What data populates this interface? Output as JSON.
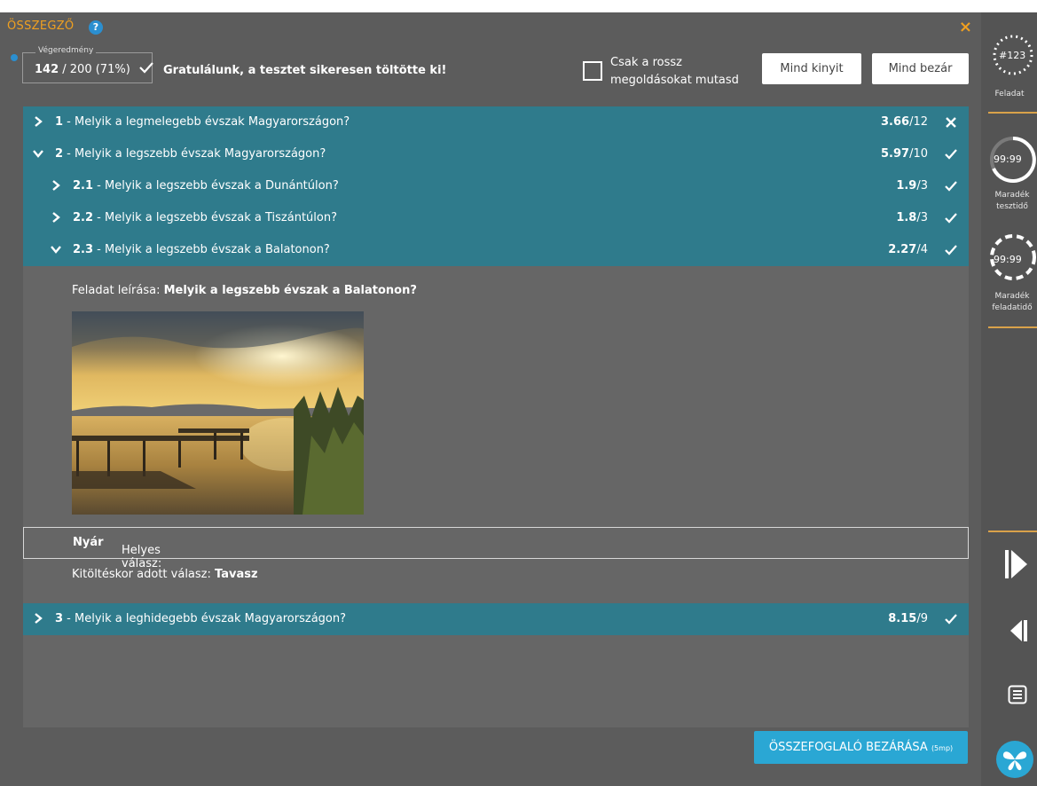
{
  "header": {
    "title": "ÖSSZEGZŐ",
    "help_icon": "?",
    "close_icon": "×"
  },
  "result": {
    "label": "Végeredmény",
    "score": "142",
    "rest": " / 200 (71%)",
    "message": "Gratulálunk, a tesztet sikeresen töltötte ki!"
  },
  "filter": {
    "checkbox_label": "Csak a rossz megoldásokat mutasd",
    "checked": false
  },
  "buttons": {
    "expand_all": "Mind kinyit",
    "collapse_all": "Mind bezár"
  },
  "questions": [
    {
      "num": "1",
      "text": " - Melyik a legmelegebb évszak Magyarországon?",
      "score": "3.66",
      "max": "/12",
      "status": "wrong",
      "expanded": false
    },
    {
      "num": "2",
      "text": " - Melyik a legszebb évszak Magyarországon?",
      "score": "5.97",
      "max": "/10",
      "status": "correct",
      "expanded": true
    },
    {
      "num": "2.1",
      "text": " - Melyik a legszebb évszak a Dunántúlon?",
      "score": "1.9",
      "max": "/3",
      "status": "correct",
      "expanded": false
    },
    {
      "num": "2.2",
      "text": " - Melyik a legszebb évszak a Tiszántúlon?",
      "score": "1.8",
      "max": "/3",
      "status": "correct",
      "expanded": false
    },
    {
      "num": "2.3",
      "text": " - Melyik a legszebb évszak a Balatonon?",
      "score": "2.27",
      "max": "/4",
      "status": "correct",
      "expanded": true
    },
    {
      "num": "3",
      "text": " - Melyik a leghidegebb évszak Magyarországon?",
      "score": "8.15",
      "max": "/9",
      "status": "correct",
      "expanded": false
    }
  ],
  "detail": {
    "desc_label": "Feladat leírása: ",
    "desc_value": "Melyik a legszebb évszak a Balatonon?",
    "correct_label": "Helyes válasz: ",
    "correct_value": "Nyár",
    "given_label": "Kitöltéskor adott válasz: ",
    "given_value": "Tavasz"
  },
  "close_button": {
    "label": "ÖSSZEFOGLALÓ BEZÁRÁSA",
    "countdown": "(5mp)"
  },
  "sidebar": {
    "task_number": "#123",
    "task_label": "Feladat",
    "test_time": "99:99",
    "test_time_label_1": "Maradék",
    "test_time_label_2": "tesztidő",
    "task_time": "99:99",
    "task_time_label_1": "Maradék",
    "task_time_label_2": "feladatidő"
  },
  "colors": {
    "accent": "#f0a020",
    "row_bg": "#2f7b8c",
    "panel_bg": "#5c5c5c",
    "button_blue": "#2aa7d4"
  }
}
